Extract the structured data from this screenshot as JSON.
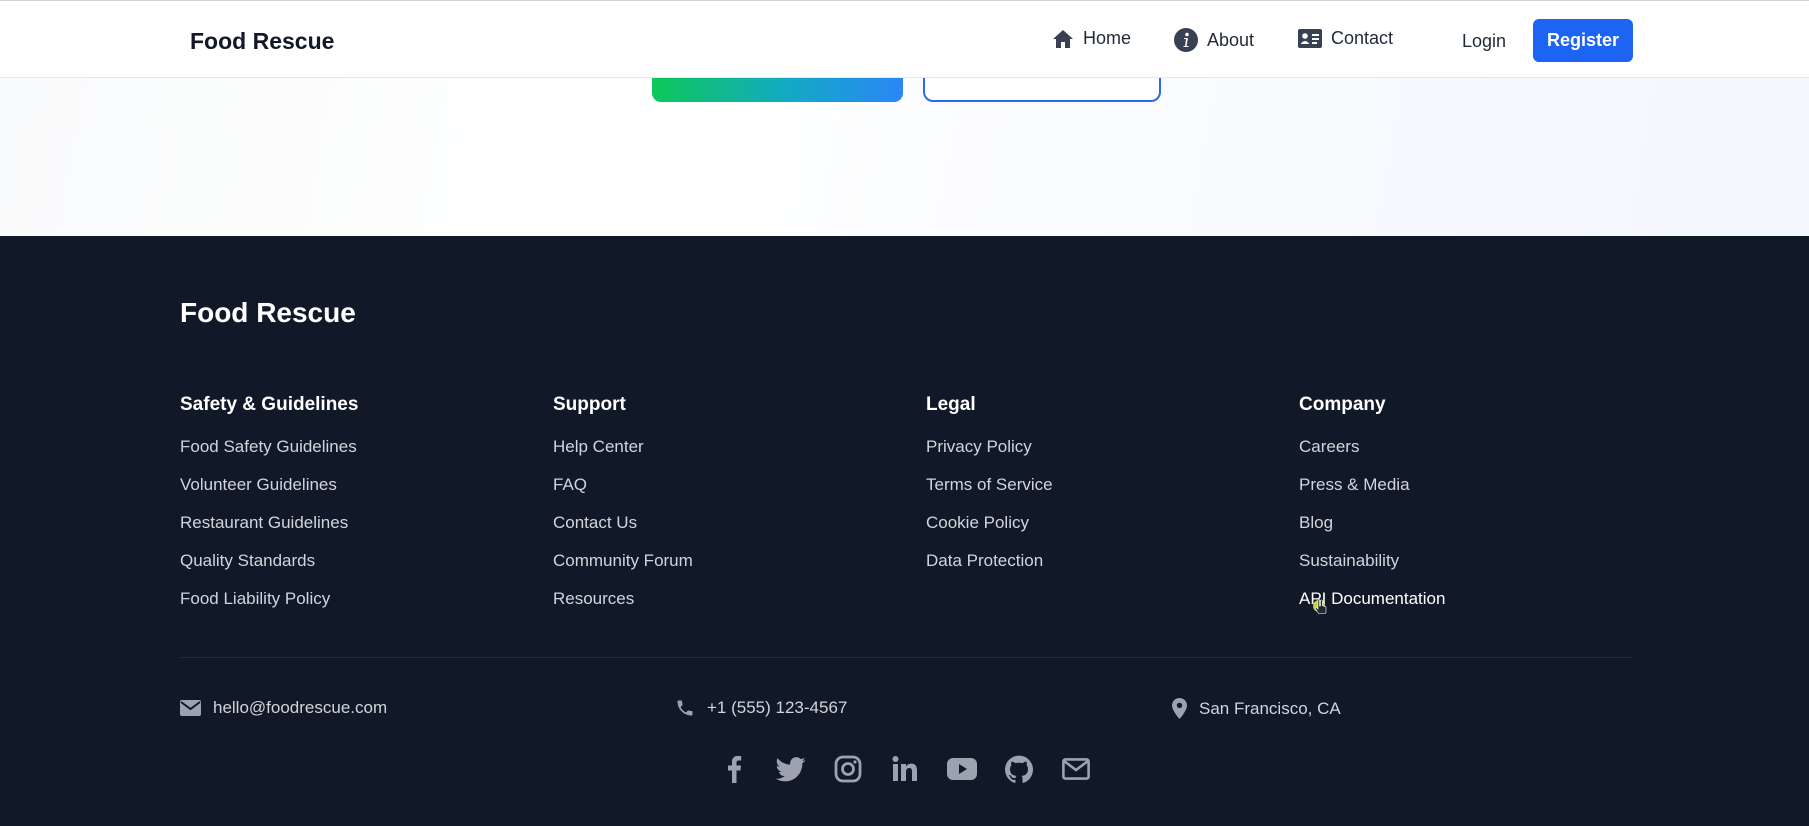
{
  "header": {
    "brand": "Food Rescue",
    "nav": [
      {
        "label": "Home",
        "icon": "home-icon"
      },
      {
        "label": "About",
        "icon": "info-icon"
      },
      {
        "label": "Contact",
        "icon": "contact-card-icon"
      }
    ],
    "login_label": "Login",
    "register_label": "Register"
  },
  "footer": {
    "brand": "Food Rescue",
    "columns": [
      {
        "title": "Safety & Guidelines",
        "links": [
          "Food Safety Guidelines",
          "Volunteer Guidelines",
          "Restaurant Guidelines",
          "Quality Standards",
          "Food Liability Policy"
        ]
      },
      {
        "title": "Support",
        "links": [
          "Help Center",
          "FAQ",
          "Contact Us",
          "Community Forum",
          "Resources"
        ]
      },
      {
        "title": "Legal",
        "links": [
          "Privacy Policy",
          "Terms of Service",
          "Cookie Policy",
          "Data Protection"
        ]
      },
      {
        "title": "Company",
        "links": [
          "Careers",
          "Press & Media",
          "Blog",
          "Sustainability",
          "API Documentation"
        ]
      }
    ],
    "contact": {
      "email": "hello@foodrescue.com",
      "phone": "+1 (555) 123-4567",
      "location": "San Francisco, CA"
    },
    "social_icons": [
      "facebook-icon",
      "twitter-icon",
      "instagram-icon",
      "linkedin-icon",
      "youtube-icon",
      "github-icon",
      "mail-icon"
    ]
  },
  "colors": {
    "primary": "#1d64f2",
    "footer_bg": "#111827",
    "gradient_start": "#0ec759",
    "gradient_end": "#2b86f6"
  }
}
